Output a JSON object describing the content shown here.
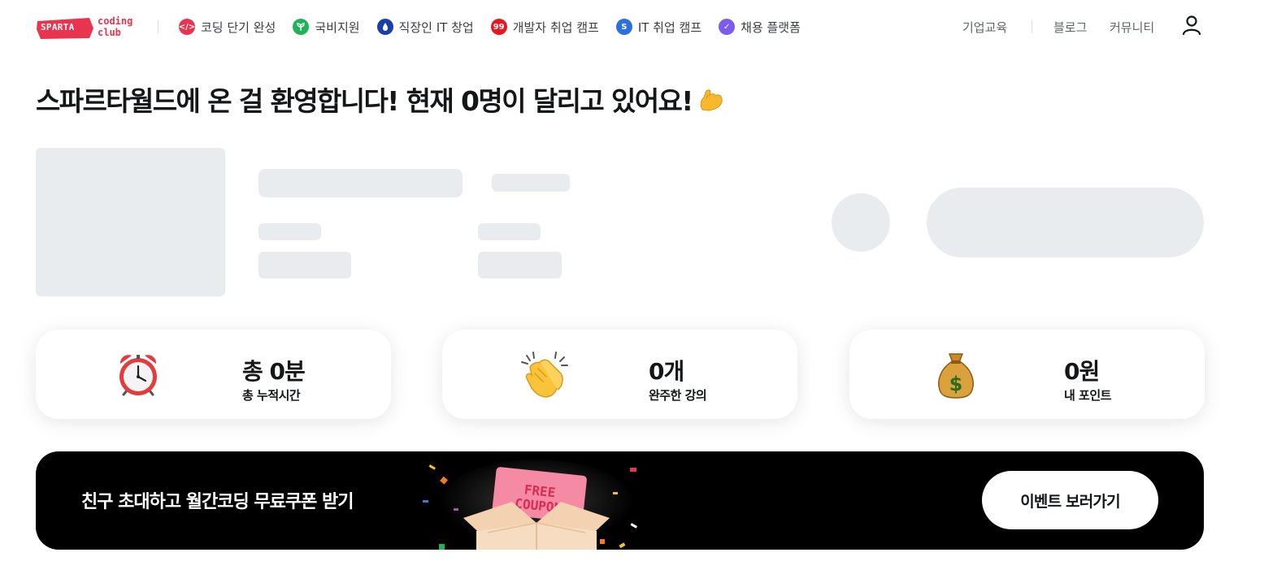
{
  "header": {
    "logo": {
      "badge": "SPARTA",
      "line1": "coding",
      "line2": "club",
      "brand_color": "#e8344e"
    },
    "nav": [
      {
        "label": "코딩 단기 완성",
        "icon": "code-icon",
        "color": "#e8344e"
      },
      {
        "label": "국비지원",
        "icon": "sprout-icon",
        "color": "#1eb358"
      },
      {
        "label": "직장인 IT 창업",
        "icon": "flame-icon",
        "color": "#1b3ea8"
      },
      {
        "label": "개발자 취업 캠프",
        "icon": "99-badge-icon",
        "color": "#e8171f"
      },
      {
        "label": "IT 취업 캠프",
        "icon": "s-badge-icon",
        "color": "#2d6fe0"
      },
      {
        "label": "채용 플랫폼",
        "icon": "check-badge-icon",
        "color": "#7c5cf0"
      }
    ],
    "right": {
      "corporate": "기업교육",
      "blog": "블로그",
      "community": "커뮤니티",
      "user_icon": "user-icon"
    }
  },
  "greeting": {
    "text": "스파르타월드에 온 걸 환영합니다! 현재 0명이 달리고 있어요!",
    "emoji": "flexed-biceps-icon"
  },
  "stats": [
    {
      "value": "총 0분",
      "label": "총 누적시간",
      "icon": "alarm-clock-icon"
    },
    {
      "value": "0개",
      "label": "완주한 강의",
      "icon": "clapping-hands-icon"
    },
    {
      "value": "0원",
      "label": "내 포인트",
      "icon": "money-bag-icon"
    }
  ],
  "banner": {
    "text": "친구 초대하고 월간코딩 무료쿠폰 받기",
    "coupon_line1": "FREE",
    "coupon_line2": "COUPON",
    "button": "이벤트 보러가기",
    "art_icon": "coupon-box-icon"
  },
  "colors": {
    "skeleton": "#e9ecef",
    "banner_bg": "#000000",
    "text": "#141617"
  }
}
